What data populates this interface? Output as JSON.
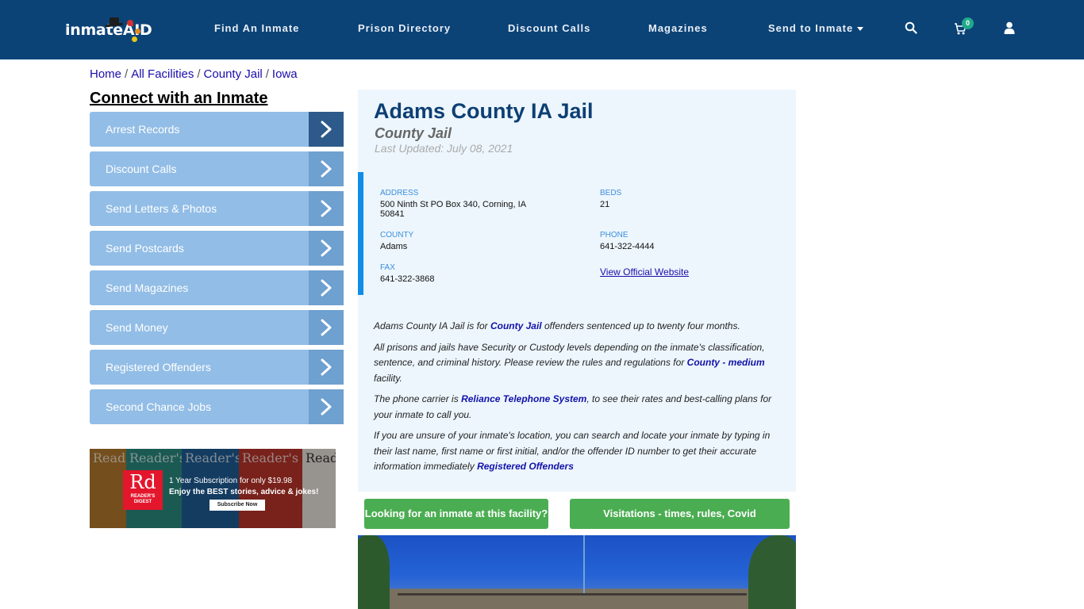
{
  "header": {
    "logo_text": "inmateAID",
    "nav": [
      {
        "label": "Find An Inmate"
      },
      {
        "label": "Prison Directory"
      },
      {
        "label": "Discount Calls"
      },
      {
        "label": "Magazines"
      },
      {
        "label": "Send to Inmate",
        "has_dropdown": true
      }
    ],
    "icons": [
      "search-icon",
      "cart-icon",
      "user-icon"
    ],
    "cart_count": "0",
    "colors": {
      "background": "#0b4377",
      "badge": "#1faa8a"
    }
  },
  "breadcrumb": [
    {
      "label": "Home"
    },
    {
      "label": "All Facilities"
    },
    {
      "label": "County Jail"
    },
    {
      "label": "Iowa"
    }
  ],
  "sidebar": {
    "title": "Connect with an Inmate",
    "items": [
      {
        "label": "Arrest Records",
        "active": true
      },
      {
        "label": "Discount Calls"
      },
      {
        "label": "Send Letters & Photos"
      },
      {
        "label": "Send Postcards"
      },
      {
        "label": "Send Magazines"
      },
      {
        "label": "Send Money"
      },
      {
        "label": "Registered Offenders"
      },
      {
        "label": "Second Chance Jobs"
      }
    ],
    "ad": {
      "brand_big": "Rd",
      "brand_small_1": "READER'S",
      "brand_small_2": "DIGEST",
      "cover_title": "Reader's",
      "line1": "1 Year Subscription for only $19.98",
      "line2": "Enjoy the BEST stories, advice & jokes!",
      "cta": "Subscribe Now"
    }
  },
  "facility": {
    "name": "Adams County IA Jail",
    "type": "County Jail",
    "last_updated": "Last Updated: July 08, 2021",
    "fields": {
      "address_label": "ADDRESS",
      "address": "500 Ninth St PO Box 340, Corning, IA 50841",
      "beds_label": "BEDS",
      "beds": "21",
      "county_label": "COUNTY",
      "county": "Adams",
      "phone_label": "PHONE",
      "phone": "641-322-4444",
      "fax_label": "FAX",
      "fax": "641-322-3868",
      "website_link": "View Official Website"
    },
    "description": {
      "p1_a": "Adams County IA Jail is for ",
      "p1_link": "County Jail",
      "p1_b": " offenders sentenced up to twenty four months.",
      "p2_a": "All prisons and jails have Security or Custody levels depending on the inmate's classification, sentence, and criminal history. Please review the rules and regulations for ",
      "p2_link": "County - medium",
      "p2_b": " facility.",
      "p3_a": "The phone carrier is ",
      "p3_link": "Reliance Telephone System",
      "p3_b": ", to see their rates and best-calling plans for your inmate to call you.",
      "p4_a": "If you are unsure of your inmate's location, you can search and locate your inmate by typing in their last name, first name or first initial, and/or the offender ID number to get their accurate information immediately ",
      "p4_link": "Registered Offenders"
    }
  },
  "actions": {
    "find_inmate": "Looking for an inmate at this facility?",
    "visitations": "Visitations - times, rules, Covid cancellations"
  }
}
